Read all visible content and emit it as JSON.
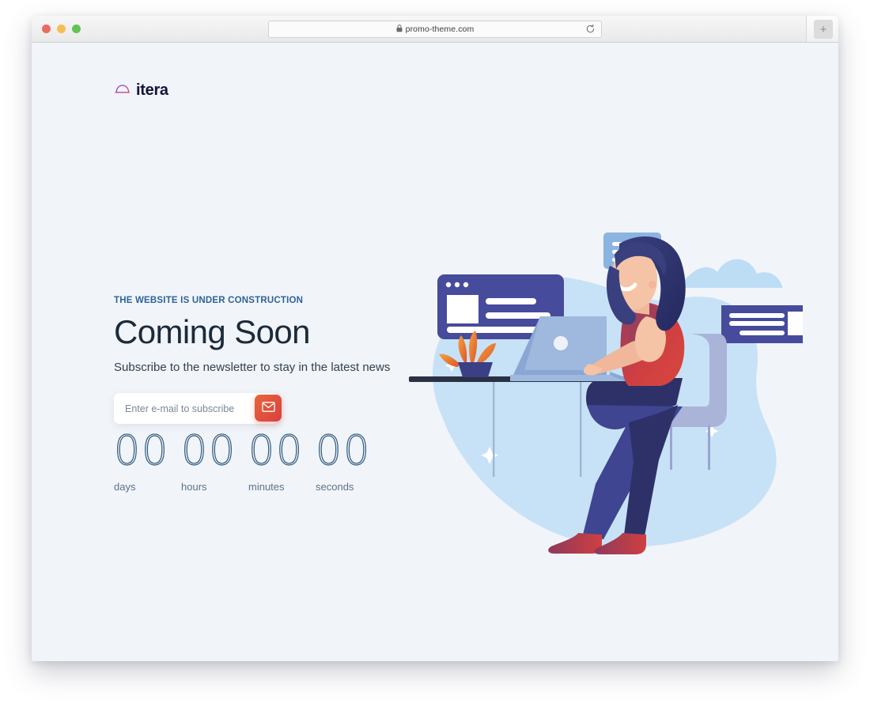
{
  "browser": {
    "url": "promo-theme.com",
    "lock_icon": "lock-icon",
    "reload_icon": "reload-icon",
    "newtab_label": "+",
    "traffic_lights": [
      "close",
      "minimize",
      "maximize"
    ]
  },
  "site": {
    "logo_text": "itera",
    "logo_icon": "arch-cloud-icon"
  },
  "hero": {
    "eyebrow": "THE WEBSITE IS UNDER CONSTRUCTION",
    "headline": "Coming Soon",
    "subtext": "Subscribe to the newsletter to stay in the latest news"
  },
  "subscribe": {
    "placeholder": "Enter e-mail to subscribe",
    "value": "",
    "button_icon": "envelope-icon"
  },
  "countdown": {
    "units": [
      {
        "value": "00",
        "label": "days"
      },
      {
        "value": "00",
        "label": "hours"
      },
      {
        "value": "00",
        "label": "minutes"
      },
      {
        "value": "00",
        "label": "seconds"
      }
    ]
  },
  "illustration": {
    "name": "woman-working-at-desk-illustration",
    "elements": [
      "background-blob",
      "browser-card",
      "chat-bubble",
      "info-card",
      "cloud",
      "woman",
      "laptop",
      "desk",
      "plant",
      "chair",
      "sparkles"
    ]
  },
  "colors": {
    "page_background": "#f1f4f9",
    "eyebrow": "#2d6496",
    "headline": "#1c2a38",
    "countdown": "#2e5a7e",
    "accent_button_start": "#e8663a",
    "accent_button_end": "#d93f3f",
    "illustration_indigo": "#474b9c",
    "illustration_light_blue": "#bcdcf5"
  }
}
